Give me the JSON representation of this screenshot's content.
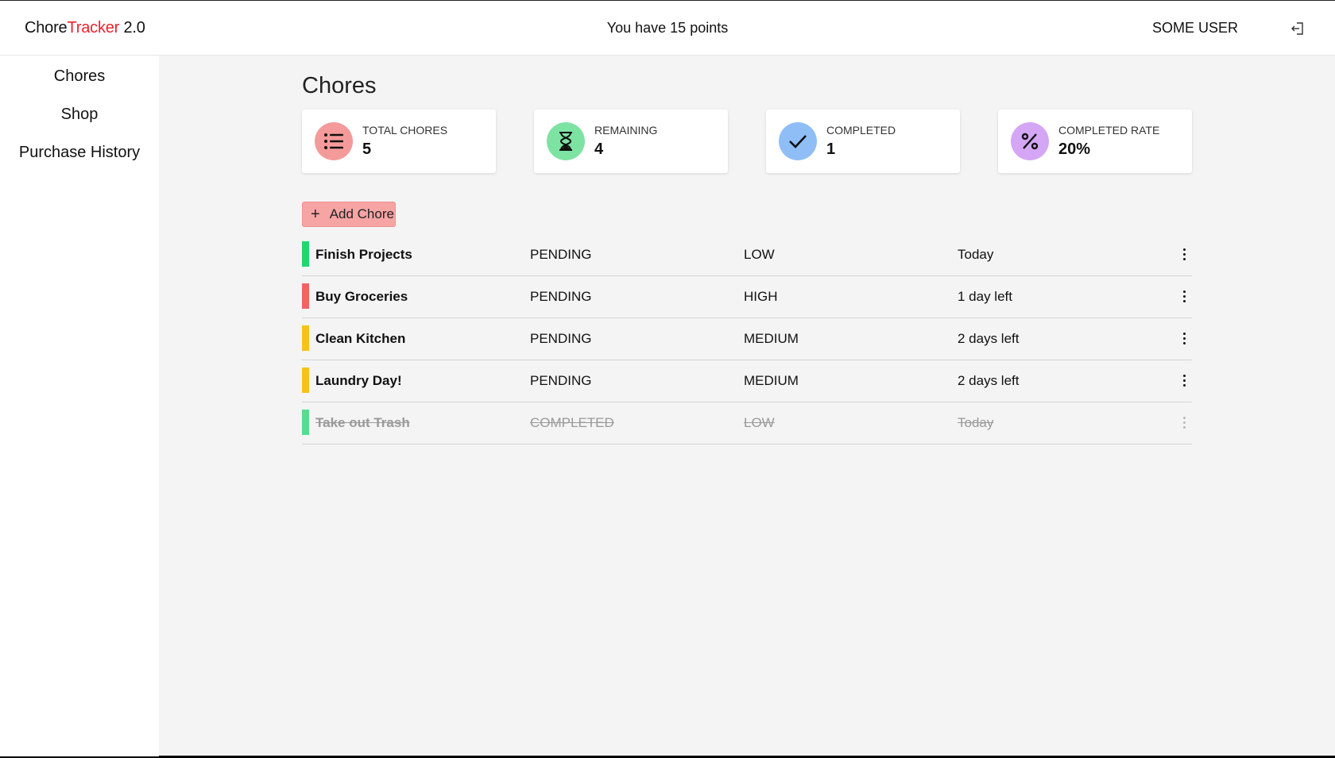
{
  "app": {
    "logo_part1": "Chore",
    "logo_part2": "Tracker",
    "logo_part3": " 2.0",
    "brand_red": "#e8242e"
  },
  "header": {
    "points_text": "You have 15 points",
    "user_name": "SOME USER",
    "logout_icon": "logout-icon"
  },
  "sidebar": {
    "items": [
      {
        "label": "Chores"
      },
      {
        "label": "Shop"
      },
      {
        "label": "Purchase History"
      }
    ]
  },
  "main": {
    "title": "Chores",
    "stats": [
      {
        "label": "TOTAL CHORES",
        "value": "5",
        "icon": "list-icon",
        "color": "#f59a9a"
      },
      {
        "label": "REMAINING",
        "value": "4",
        "icon": "hourglass-icon",
        "color": "#7de3a2"
      },
      {
        "label": "COMPLETED",
        "value": "1",
        "icon": "check-icon",
        "color": "#8fbef7"
      },
      {
        "label": "COMPLETED RATE",
        "value": "20%",
        "icon": "percent-icon",
        "color": "#d4a6f5"
      }
    ],
    "add_button_label": "Add Chore",
    "chores": [
      {
        "name": "Finish Projects",
        "status": "PENDING",
        "priority": "LOW",
        "due": "Today",
        "color": "#22d66e"
      },
      {
        "name": "Buy Groceries",
        "status": "PENDING",
        "priority": "HIGH",
        "due": "1 day left",
        "color": "#f06464"
      },
      {
        "name": "Clean Kitchen",
        "status": "PENDING",
        "priority": "MEDIUM",
        "due": "2 days left",
        "color": "#f7c31a"
      },
      {
        "name": "Laundry Day!",
        "status": "PENDING",
        "priority": "MEDIUM",
        "due": "2 days left",
        "color": "#f7c31a"
      },
      {
        "name": "Take out Trash",
        "status": "COMPLETED",
        "priority": "LOW",
        "due": "Today",
        "color": "#22d66e"
      }
    ]
  }
}
